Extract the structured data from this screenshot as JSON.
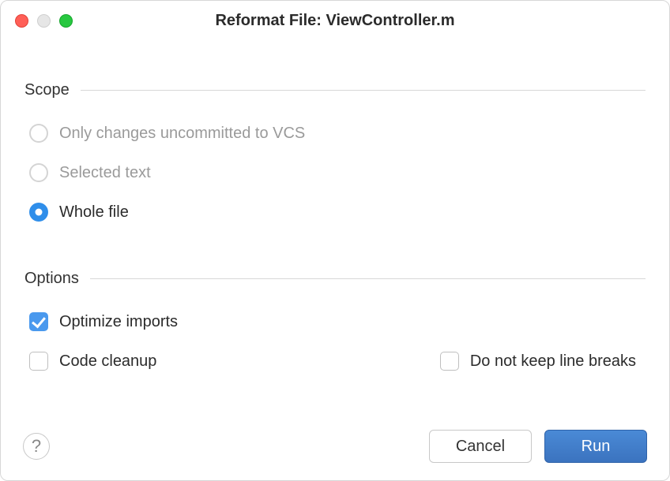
{
  "title": "Reformat File: ViewController.m",
  "sections": {
    "scope": {
      "label": "Scope",
      "options": [
        {
          "label": "Only changes uncommitted to VCS",
          "selected": false,
          "enabled": false
        },
        {
          "label": "Selected text",
          "selected": false,
          "enabled": false
        },
        {
          "label": "Whole file",
          "selected": true,
          "enabled": true
        }
      ]
    },
    "options": {
      "label": "Options",
      "optimize_imports": {
        "label": "Optimize imports",
        "checked": true
      },
      "code_cleanup": {
        "label": "Code cleanup",
        "checked": false
      },
      "no_line_breaks": {
        "label": "Do not keep line breaks",
        "checked": false
      }
    }
  },
  "buttons": {
    "help": "?",
    "cancel": "Cancel",
    "run": "Run"
  }
}
